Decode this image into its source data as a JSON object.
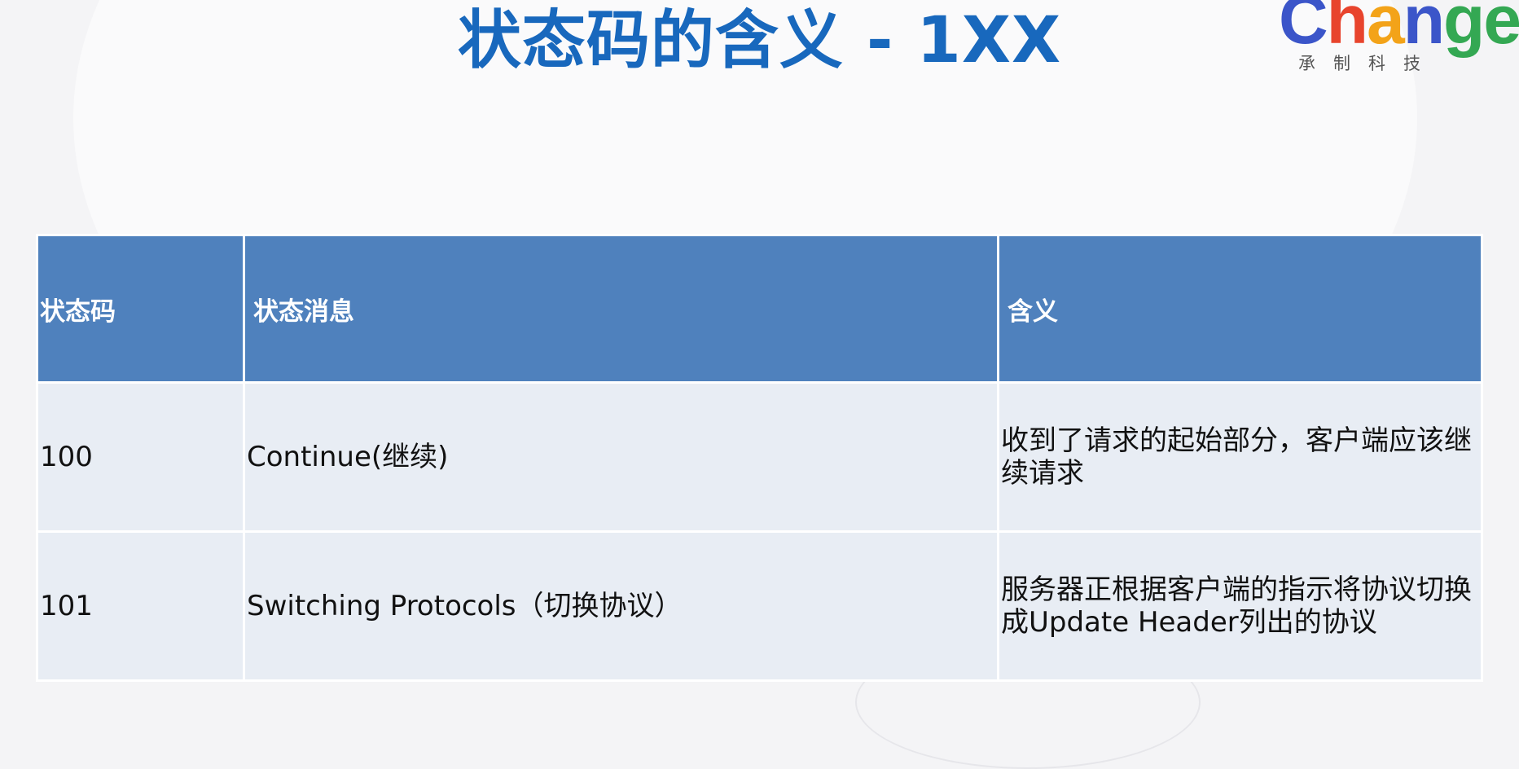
{
  "slide": {
    "title": "状态码的含义 - 1XX"
  },
  "logo": {
    "letters": [
      "C",
      "h",
      "a",
      "n",
      "g",
      "e"
    ],
    "subtitle": "承制科技"
  },
  "table": {
    "headers": [
      "状态码",
      "状态消息",
      "含义"
    ],
    "rows": [
      {
        "code": "100",
        "message": "Continue(继续)",
        "meaning": "收到了请求的起始部分，客户端应该继续请求"
      },
      {
        "code": "101",
        "message": "Switching Protocols（切换协议）",
        "meaning": "服务器正根据客户端的指示将协议切换成Update Header列出的协议"
      }
    ]
  },
  "colors": {
    "title": "#1868bd",
    "header_bg": "#4f81bd",
    "row_bg": "#e8edf4",
    "logo_blue": "#3b55c9",
    "logo_red": "#e8442d",
    "logo_orange": "#f3a319",
    "logo_green": "#34a853"
  }
}
